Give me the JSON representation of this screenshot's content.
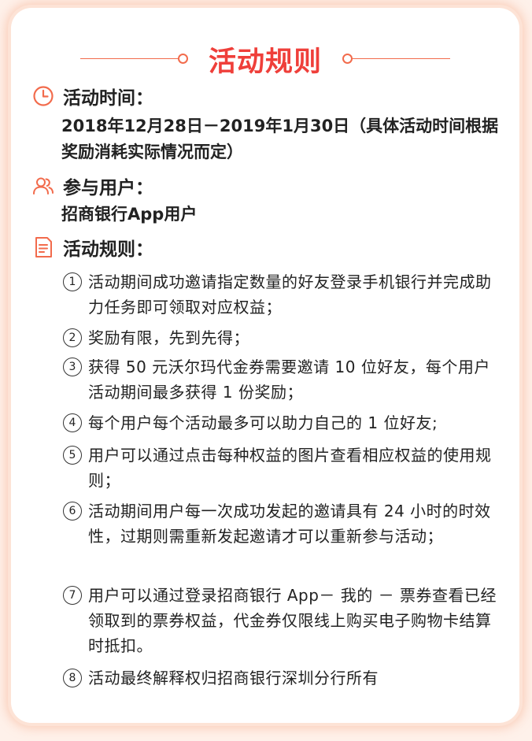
{
  "title": "活动规则",
  "sections": {
    "time": {
      "icon": "clock-icon",
      "heading": "活动时间：",
      "text": "2018年12月28日－2019年1月30日（具体活动时间根据奖励消耗实际情况而定）"
    },
    "users": {
      "icon": "users-icon",
      "heading": "参与用户：",
      "text": "招商银行App用户"
    },
    "rules": {
      "icon": "document-icon",
      "heading": "活动规则：",
      "items": [
        {
          "num": "1",
          "text": "活动期间成功邀请指定数量的好友登录手机银行并完成助力任务即可领取对应权益；"
        },
        {
          "num": "2",
          "text": "奖励有限，先到先得；"
        },
        {
          "num": "3",
          "text": "获得 50 元沃尔玛代金券需要邀请 10 位好友，每个用户活动期间最多获得 1 份奖励；"
        },
        {
          "num": "4",
          "text": "每个用户每个活动最多可以助力自己的 1 位好友;"
        },
        {
          "num": "5",
          "text": "用户可以通过点击每种权益的图片查看相应权益的使用规则；"
        },
        {
          "num": "6",
          "text": "活动期间用户每一次成功发起的邀请具有 24 小时的时效性，过期则需重新发起邀请才可以重新参与活动；"
        },
        {
          "num": "7",
          "text": "用户可以通过登录招商银行 App－ 我的 － 票券查看已经领取到的票券权益，代金券仅限线上购买电子购物卡结算时抵扣。"
        },
        {
          "num": "8",
          "text": "活动最终解释权归招商银行深圳分行所有"
        }
      ]
    }
  },
  "colors": {
    "accent": "#ef3f3a",
    "icon": "#f26b4c",
    "background": "#fef1ea",
    "card": "#ffffff",
    "text": "#222222"
  }
}
